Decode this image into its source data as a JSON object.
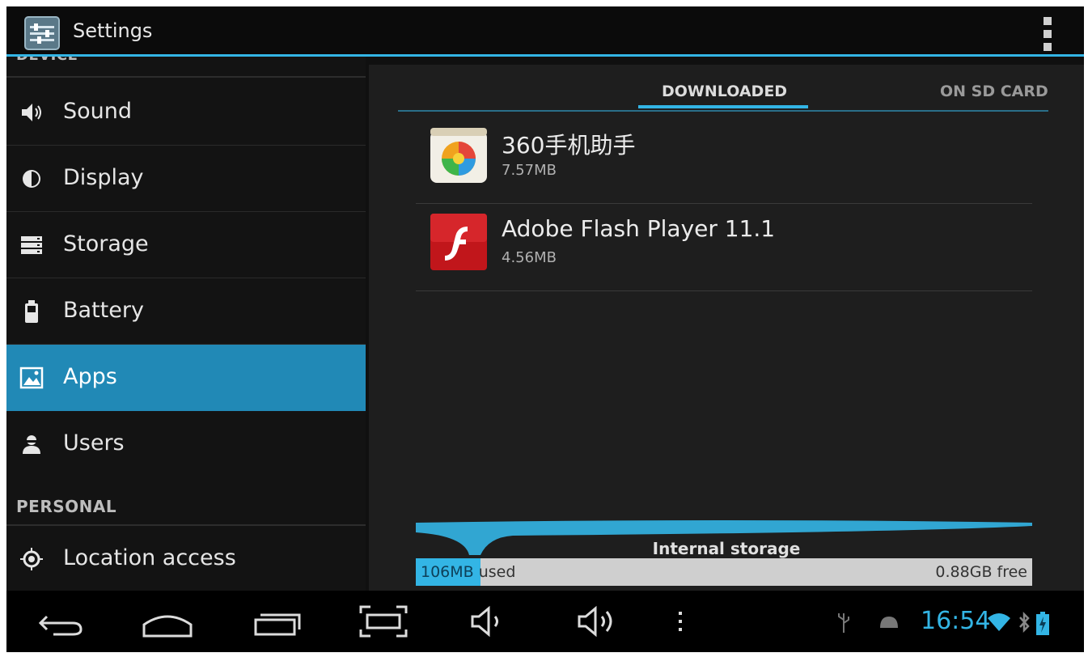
{
  "actionbar": {
    "title": "Settings"
  },
  "sidebar": {
    "cut_header": "DEVICE",
    "items": [
      {
        "label": "Sound",
        "icon": "speaker-icon"
      },
      {
        "label": "Display",
        "icon": "brightness-icon"
      },
      {
        "label": "Storage",
        "icon": "storage-icon"
      },
      {
        "label": "Battery",
        "icon": "battery-icon"
      },
      {
        "label": "Apps",
        "icon": "apps-icon",
        "selected": true
      },
      {
        "label": "Users",
        "icon": "user-icon"
      }
    ],
    "personal_header": "PERSONAL",
    "personal_items": [
      {
        "label": "Location access",
        "icon": "location-icon"
      }
    ]
  },
  "tabs": [
    {
      "label": "DOWNLOADED",
      "selected": true
    },
    {
      "label": "ON SD CARD",
      "selected": false
    }
  ],
  "apps": [
    {
      "name": "360手机助手",
      "size": "7.57MB",
      "icon": "app-360-icon"
    },
    {
      "name": "Adobe Flash Player 11.1",
      "size": "4.56MB",
      "icon": "flash-player-icon"
    }
  ],
  "storage": {
    "label": "Internal storage",
    "used_value": "106MB",
    "used_suffix": " used",
    "free_text": "0.88GB free",
    "used_fraction": 0.105
  },
  "statusbar": {
    "time": "16:54"
  },
  "colors": {
    "accent": "#33b5e5",
    "selected_row": "#2189b6",
    "flash_red": "#c1161b"
  }
}
